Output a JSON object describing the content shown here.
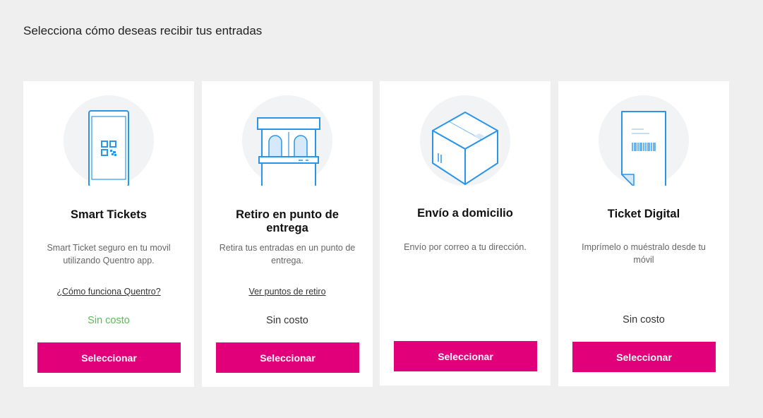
{
  "page": {
    "title": "Selecciona cómo deseas recibir tus entradas"
  },
  "colors": {
    "accent": "#e2007a",
    "icon_stroke": "#2b95e9",
    "icon_bg": "#f1f3f5",
    "free_text": "#5cb85c"
  },
  "cards": [
    {
      "icon": "smartphone-qr-icon",
      "title": "Smart Tickets",
      "description": "Smart Ticket seguro en tu movil utilizando Quentro app.",
      "link": "¿Cómo funciona Quentro?",
      "price": "Sin costo",
      "button": "Seleccionar"
    },
    {
      "icon": "ticket-booth-icon",
      "title": "Retiro en punto de entrega",
      "description": "Retira tus entradas en un punto de entrega.",
      "link": "Ver puntos de retiro",
      "price": "Sin costo",
      "button": "Seleccionar"
    },
    {
      "icon": "delivery-box-icon",
      "title": "Envío a domicilio",
      "description": "Envío por correo a tu dirección.",
      "button": "Seleccionar"
    },
    {
      "icon": "digital-ticket-icon",
      "title": "Ticket Digital",
      "description": "Imprímelo o muéstralo desde tu móvil",
      "price": "Sin costo",
      "button": "Seleccionar"
    }
  ]
}
